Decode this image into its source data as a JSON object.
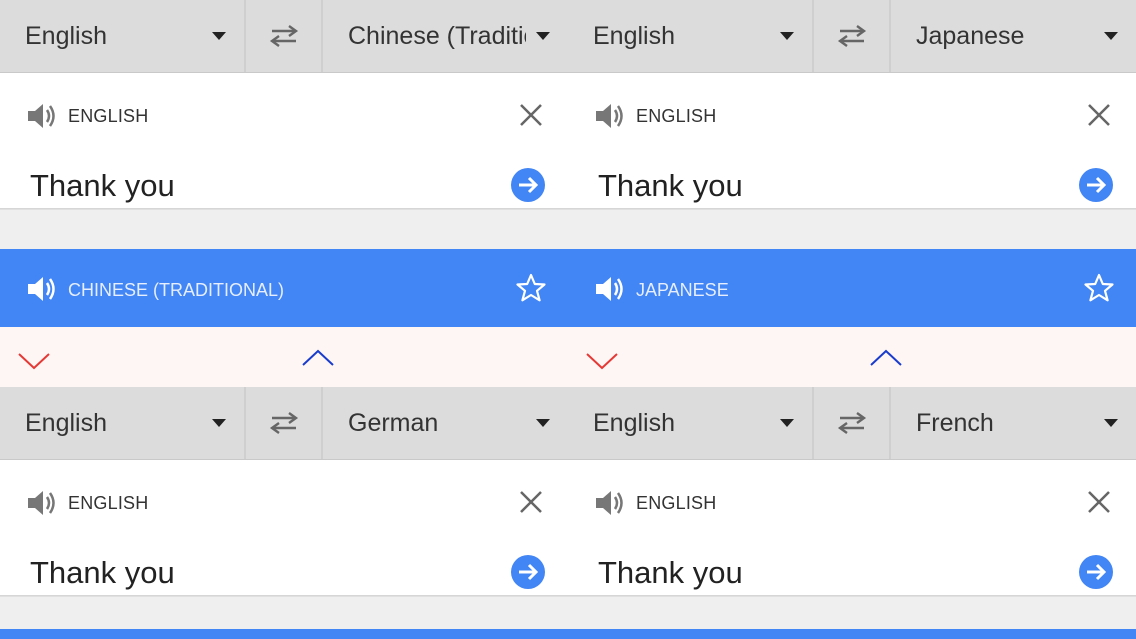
{
  "panels": [
    {
      "source_lang": "English",
      "target_lang": "Chinese (Traditional)",
      "input_lang_label": "ENGLISH",
      "input_text": "Thank you",
      "result_lang_label": "CHINESE (TRADITIONAL)"
    },
    {
      "source_lang": "English",
      "target_lang": "Japanese",
      "input_lang_label": "ENGLISH",
      "input_text": "Thank you",
      "result_lang_label": "JAPANESE"
    },
    {
      "source_lang": "English",
      "target_lang": "German",
      "input_lang_label": "ENGLISH",
      "input_text": "Thank you"
    },
    {
      "source_lang": "English",
      "target_lang": "French",
      "input_lang_label": "ENGLISH",
      "input_text": "Thank you"
    }
  ],
  "icons": {
    "swap": "swap-arrows-icon",
    "speaker": "speaker-icon",
    "clear": "close-icon",
    "submit": "arrow-right-circle-icon",
    "favorite": "star-outline-icon",
    "collapse": "chevron-down-icon",
    "expand": "chevron-up-icon"
  },
  "colors": {
    "accent": "#4285f4",
    "lang_bar": "#dcdcdc",
    "chevron_down": "#e53935",
    "chevron_up": "#1a3ccc"
  }
}
